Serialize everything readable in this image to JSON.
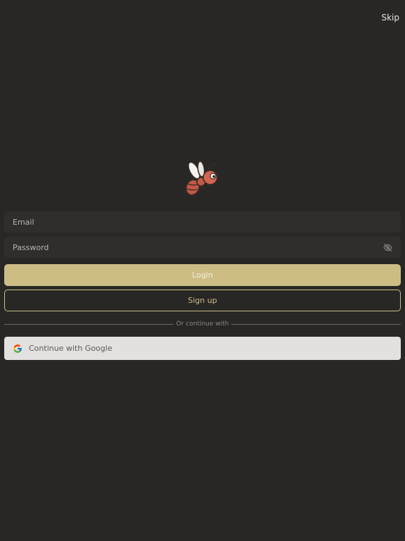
{
  "header": {
    "skip_label": "Skip"
  },
  "logo": {
    "icon": "bee-mascot-icon"
  },
  "form": {
    "email": {
      "placeholder": "Email",
      "value": ""
    },
    "password": {
      "placeholder": "Password",
      "value": "",
      "toggle_icon": "eye-off-icon"
    }
  },
  "actions": {
    "login_label": "Login",
    "signup_label": "Sign up"
  },
  "divider": {
    "text": "Or continue with"
  },
  "social": {
    "google_label": "Continue with Google",
    "google_icon": "google-g-icon"
  },
  "colors": {
    "background": "#282726",
    "field": "#2f2e2c",
    "accent": "#cdbd85",
    "google_button": "#e2e1df"
  }
}
